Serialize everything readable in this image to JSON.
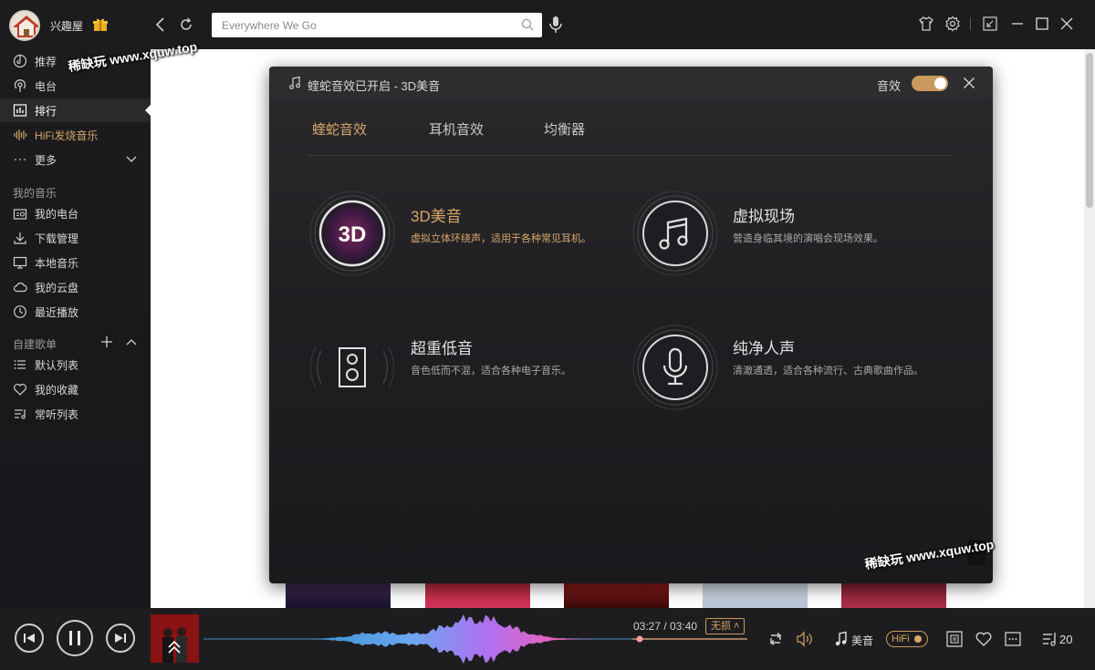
{
  "topbar": {
    "username": "兴趣屋",
    "search_placeholder": "Everywhere We Go",
    "icons": [
      "gift-icon",
      "back-icon",
      "refresh-icon",
      "search-icon",
      "microphone-icon",
      "skin-icon",
      "settings-icon",
      "mini-mode-icon",
      "minimize-icon",
      "maximize-icon",
      "close-icon"
    ]
  },
  "sidebar": {
    "nav": [
      {
        "label": "推荐",
        "icon": "disc-icon"
      },
      {
        "label": "电台",
        "icon": "radio-icon"
      },
      {
        "label": "排行",
        "icon": "chart-icon",
        "active": true
      },
      {
        "label": "HiFi发烧音乐",
        "icon": "hifi-wave-icon"
      },
      {
        "label": "更多",
        "icon": "more-dots-icon"
      }
    ],
    "my_music_title": "我的音乐",
    "my_music": [
      {
        "label": "我的电台",
        "icon": "my-radio-icon"
      },
      {
        "label": "下载管理",
        "icon": "download-icon"
      },
      {
        "label": "本地音乐",
        "icon": "monitor-icon"
      },
      {
        "label": "我的云盘",
        "icon": "cloud-icon"
      },
      {
        "label": "最近播放",
        "icon": "clock-icon"
      }
    ],
    "playlists_title": "自建歌单",
    "playlists": [
      {
        "label": "默认列表",
        "icon": "list-icon"
      },
      {
        "label": "我的收藏",
        "icon": "heart-icon"
      },
      {
        "label": "常听列表",
        "icon": "playlist-icon"
      }
    ]
  },
  "dialog": {
    "title": "蝰蛇音效已开启 - 3D美音",
    "effect_toggle_label": "音效",
    "effect_enabled": true,
    "tabs": [
      "蝰蛇音效",
      "耳机音效",
      "均衡器"
    ],
    "active_tab": 0,
    "effects": [
      {
        "title": "3D美音",
        "desc": "虚拟立体环绕声，适用于各种常见耳机。",
        "icon": "3d-icon",
        "icon_text": "3D",
        "active": true
      },
      {
        "title": "虚拟现场",
        "desc": "营造身临其境的演唱会现场效果。",
        "icon": "music-note-icon",
        "active": false
      },
      {
        "title": "超重低音",
        "desc": "音色低而不混，适合各种电子音乐。",
        "icon": "speaker-icon",
        "active": false
      },
      {
        "title": "纯净人声",
        "desc": "清澈通透，适合各种流行、古典歌曲作品。",
        "icon": "microphone-icon",
        "active": false
      }
    ]
  },
  "player": {
    "current_time": "03:27",
    "total_time": "03:40",
    "time_display": "03:27 / 03:40",
    "progress": 0.94,
    "quality_label": "无损",
    "sound_effect_label": "美音",
    "hifi_label": "HiFi",
    "queue_count": "20"
  },
  "watermark": "稀缺玩 www.xquw.top",
  "colors": {
    "accent_gold": "#d9a66a",
    "background": "#1c1c1e",
    "content": "#ffffff"
  }
}
